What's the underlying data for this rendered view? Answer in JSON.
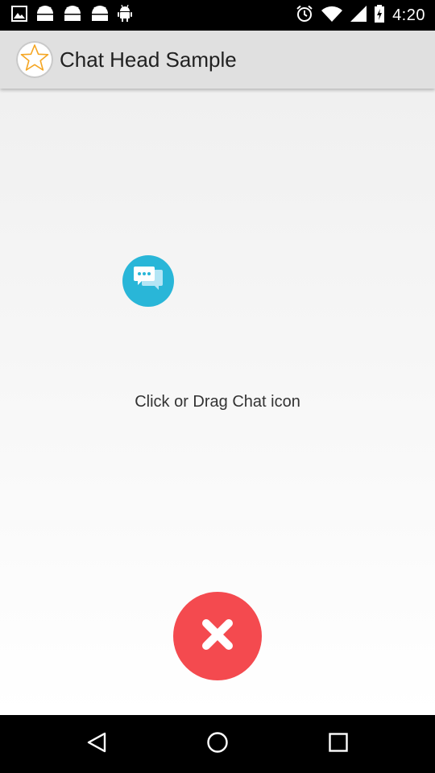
{
  "status_bar": {
    "time": "4:20",
    "left_icons": [
      "gallery-icon",
      "android-icon",
      "android-icon",
      "android-icon",
      "android-debug-icon"
    ],
    "right_icons": [
      "alarm-icon",
      "wifi-icon",
      "signal-icon",
      "battery-charging-icon"
    ]
  },
  "app_bar": {
    "title": "Chat Head Sample",
    "logo_icon": "star-icon",
    "background": "#e0e0e0"
  },
  "content": {
    "chat_head_icon": "chat-bubbles-icon",
    "chat_head_color": "#29b6d8",
    "instruction": "Click or Drag Chat icon",
    "close_icon": "close-x-icon",
    "close_color": "#f44a4f"
  },
  "nav_bar": {
    "buttons": [
      "back-icon",
      "home-icon",
      "recents-icon"
    ]
  }
}
